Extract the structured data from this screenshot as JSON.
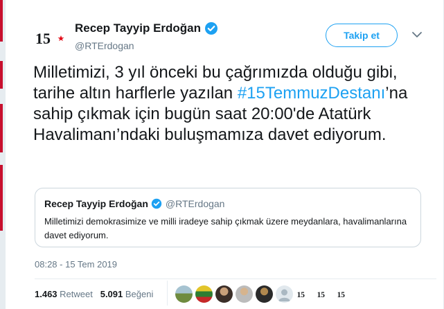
{
  "tweet": {
    "author_name": "Recep Tayyip Erdoğan",
    "author_handle": "@RTErdogan",
    "follow_label": "Takip et",
    "text_part1": "Milletimizi, 3 yıl önceki bu çağrımızda olduğu gibi, tarihe altın harflerle yazılan ",
    "hashtag": "#15TemmuzDestanı",
    "text_part2": "’na sahip çıkmak için bugün saat 20:00'de Atatürk Havalimanı’ndaki buluşmamıza davet ediyorum.",
    "avatar_icon": "15-temmuz-logo-icon"
  },
  "quote": {
    "author_name": "Recep Tayyip Erdoğan",
    "author_handle": "@RTErdogan",
    "text": "Milletimizi demokrasimize ve milli iradeye sahip çıkmak üzere meydanlara, havalimanlarına davet ediyorum."
  },
  "meta": {
    "timestamp": "08:28 - 15 Tem 2019",
    "retweets_count": "1.463",
    "retweets_label": "Retweet",
    "likes_count": "5.091",
    "likes_label": "Beğeni"
  },
  "colors": {
    "accent": "#1da1f2",
    "text": "#14171a",
    "muted": "#657786",
    "brand_red": "#e30a17"
  }
}
